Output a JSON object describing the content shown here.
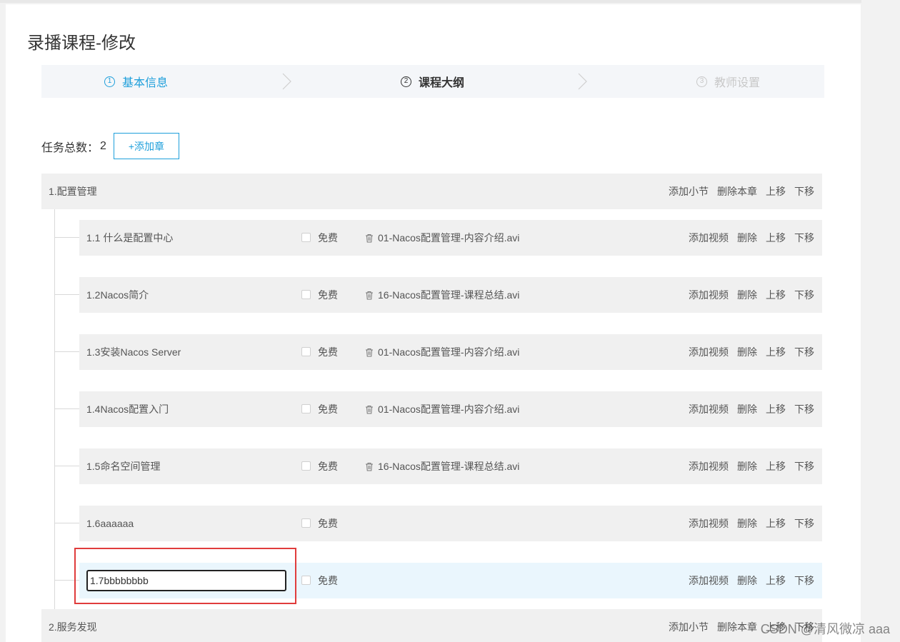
{
  "page_title": "录播课程-修改",
  "steps": [
    {
      "num": "1",
      "label": "基本信息",
      "state": "done"
    },
    {
      "num": "2",
      "label": "课程大纲",
      "state": "current"
    },
    {
      "num": "3",
      "label": "教师设置",
      "state": "pending"
    }
  ],
  "task_count": {
    "label": "任务总数：",
    "value": "2"
  },
  "add_chapter_label": "+添加章",
  "chapter_actions": {
    "add_section": "添加小节",
    "delete_chapter": "删除本章",
    "move_up": "上移",
    "move_down": "下移"
  },
  "section_actions": {
    "add_video": "添加视频",
    "delete": "删除",
    "move_up": "上移",
    "move_down": "下移"
  },
  "free_label": "免费",
  "chapters": [
    {
      "title": "1.配置管理"
    },
    {
      "title": "2.服务发现"
    }
  ],
  "sections": [
    {
      "title": "1.1 什么是配置中心",
      "video": "01-Nacos配置管理-内容介绍.avi"
    },
    {
      "title": "1.2Nacos简介",
      "video": "16-Nacos配置管理-课程总结.avi"
    },
    {
      "title": "1.3安装Nacos Server",
      "video": "01-Nacos配置管理-内容介绍.avi"
    },
    {
      "title": "1.4Nacos配置入门",
      "video": "01-Nacos配置管理-内容介绍.avi"
    },
    {
      "title": "1.5命名空间管理",
      "video": "16-Nacos配置管理-课程总结.avi"
    },
    {
      "title": "1.6aaaaaa",
      "video": ""
    },
    {
      "title": "1.7bbbbbbbb",
      "video": "",
      "editing": true
    }
  ],
  "watermark": "CSDN @清风微凉 aaa",
  "colors": {
    "accent": "#1e9fdb",
    "highlight": "#e03c3c",
    "row_bg": "#f0f0f0",
    "active_row_bg": "#eaf6fd"
  }
}
